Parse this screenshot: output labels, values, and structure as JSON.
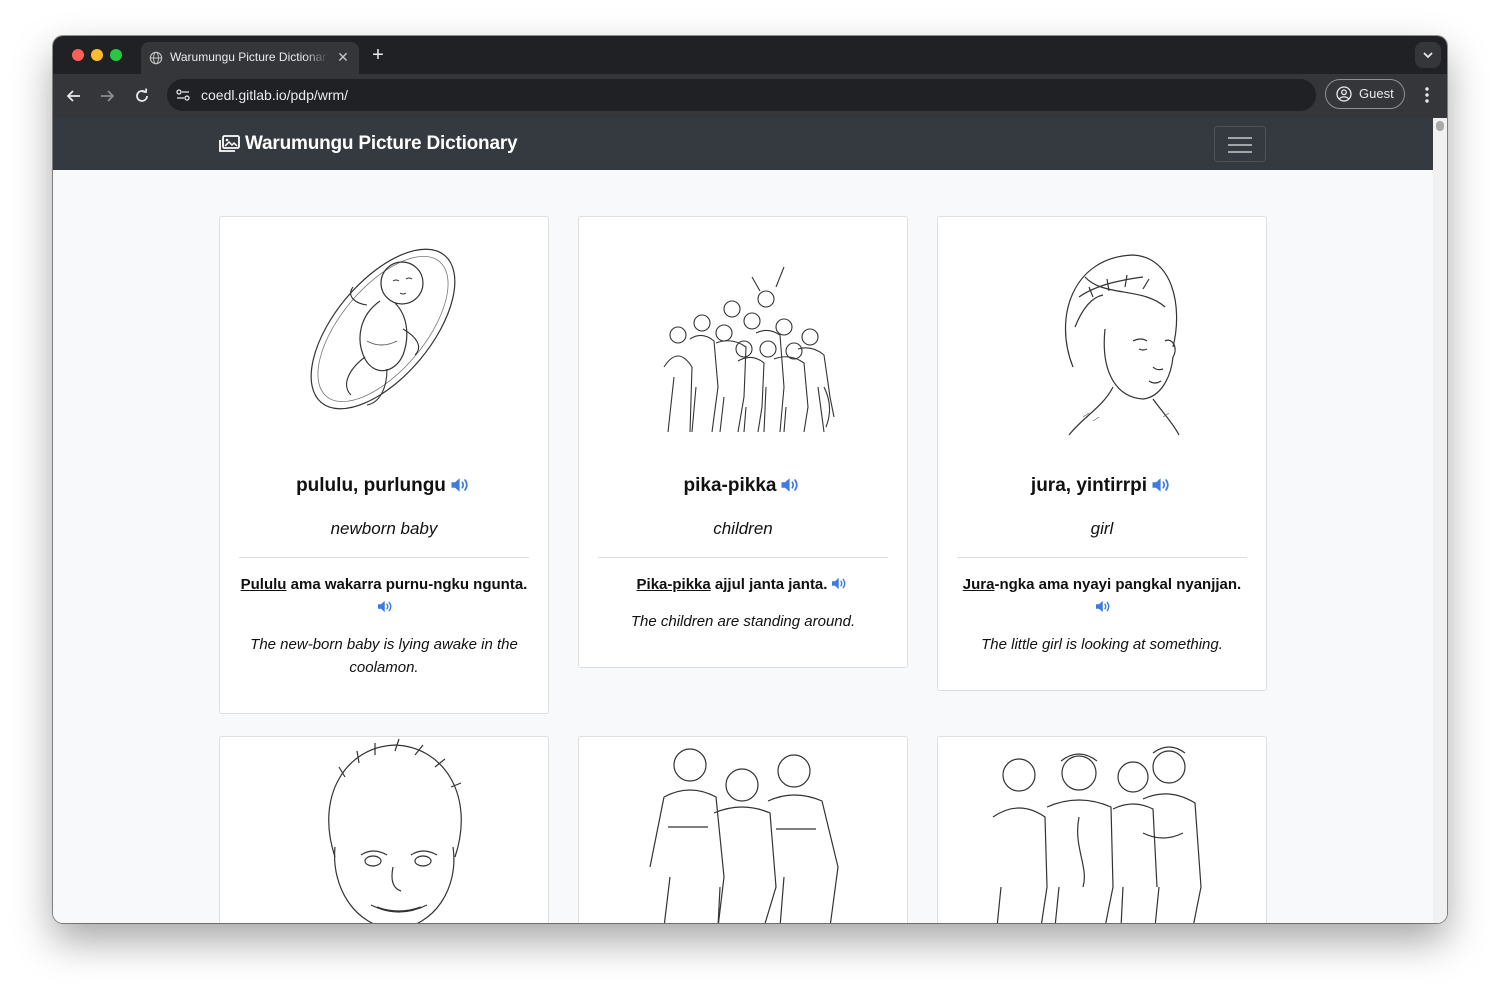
{
  "browser": {
    "tab_title": "Warumungu Picture Dictionary",
    "url": "coedl.gitlab.io/pdp/wrm/",
    "profile_label": "Guest",
    "new_tab_symbol": "+",
    "close_symbol": "✕"
  },
  "site": {
    "brand": "Warumungu Picture Dictionary"
  },
  "cards": [
    {
      "word": "pululu, purlungu",
      "gloss": "newborn baby",
      "example_head": "Pululu",
      "example_rest": " ama wakarra purnu-ngku ngunta.",
      "translation": "The new-born baby is lying awake in the coolamon.",
      "image": "baby-in-coolamon-illustration"
    },
    {
      "word": "pika-pikka",
      "gloss": "children",
      "example_head": "Pika-pikka",
      "example_rest": " ajjul janta janta.",
      "translation": "The children are standing around.",
      "image": "group-of-children-illustration"
    },
    {
      "word": "jura, yintirrpi",
      "gloss": "girl",
      "example_head": "Jura",
      "example_rest": "-ngka ama nyayi pangkal nyanjjan.",
      "translation": "The little girl is looking at something.",
      "image": "girl-portrait-illustration"
    },
    {
      "image": "boy-portrait-illustration"
    },
    {
      "image": "three-women-illustration"
    },
    {
      "image": "group-of-men-illustration"
    }
  ],
  "colors": {
    "navbar": "#343a40",
    "page_bg": "#f8f9fa",
    "speaker_icon": "#3d7be0",
    "browser_dark": "#202124",
    "browser_toolbar": "#35363a"
  }
}
